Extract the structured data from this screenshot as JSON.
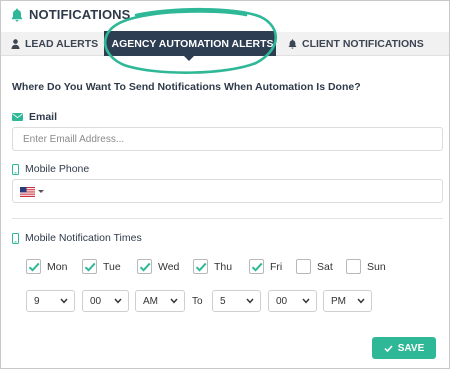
{
  "header": {
    "title": "NOTIFICATIONS",
    "icon": "bell-icon"
  },
  "tabs": [
    {
      "label": "LEAD ALERTS",
      "icon": "user-icon",
      "active": false
    },
    {
      "label": "AGENCY AUTOMATION ALERTS",
      "icon": "building-icon",
      "active": true
    },
    {
      "label": "CLIENT NOTIFICATIONS",
      "icon": "bell-icon",
      "active": false
    }
  ],
  "form": {
    "question": "Where Do You Want To Send Notifications When Automation Is Done?",
    "email_label": "Email",
    "email_placeholder": "Enter Emaill Address...",
    "email_value": "",
    "phone_label": "Mobile Phone",
    "phone_country": "US",
    "phone_value": "",
    "times_label": "Mobile Notification Times",
    "days": [
      {
        "label": "Mon",
        "checked": true
      },
      {
        "label": "Tue",
        "checked": true
      },
      {
        "label": "Wed",
        "checked": true
      },
      {
        "label": "Thu",
        "checked": true
      },
      {
        "label": "Fri",
        "checked": true
      },
      {
        "label": "Sat",
        "checked": false
      },
      {
        "label": "Sun",
        "checked": false
      }
    ],
    "start": {
      "hour": "9",
      "minute": "00",
      "period": "AM"
    },
    "to_label": "To",
    "end": {
      "hour": "5",
      "minute": "00",
      "period": "PM"
    },
    "save_label": "SAVE"
  },
  "colors": {
    "accent": "#2fb897",
    "tab_active_bg": "#2d3e52",
    "highlight_ring": "#2fb897",
    "checkmark": "#2fb897"
  }
}
